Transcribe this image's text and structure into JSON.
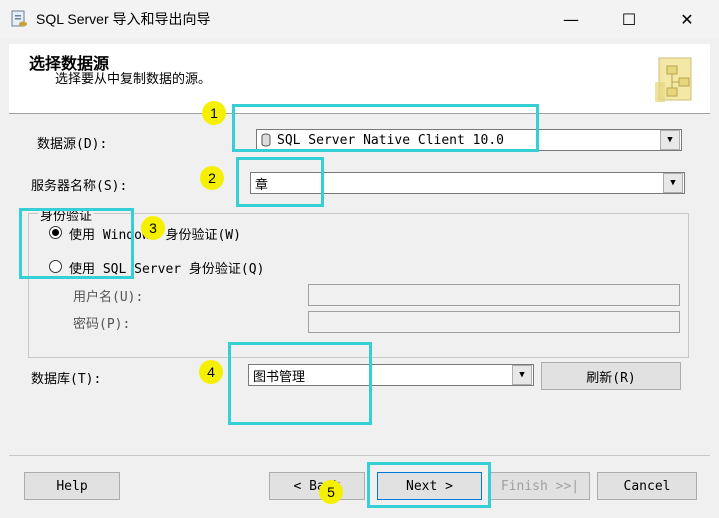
{
  "window": {
    "title": "SQL Server 导入和导出向导"
  },
  "header": {
    "title": "选择数据源",
    "subtitle": "选择要从中复制数据的源。"
  },
  "form": {
    "datasource_label": "数据源(D):",
    "datasource_value": "SQL Server Native Client 10.0",
    "server_label": "服务器名称(S):",
    "server_value": "章",
    "auth_group_label": "身份验证",
    "windows_auth_label": "使用 Windows 身份验证(W)",
    "sql_auth_label": "使用 SQL Server 身份验证(Q)",
    "username_label": "用户名(U):",
    "password_label": "密码(P):",
    "database_label": "数据库(T):",
    "database_value": "图书管理",
    "refresh_label": "刷新(R)"
  },
  "footer": {
    "help": "Help",
    "back": "< Back",
    "next": "Next >",
    "finish": "Finish >>|",
    "cancel": "Cancel"
  },
  "annotations": [
    "1",
    "2",
    "3",
    "4",
    "5"
  ],
  "colors": {
    "highlight": "#35cfd6",
    "badge": "#f5f000"
  }
}
